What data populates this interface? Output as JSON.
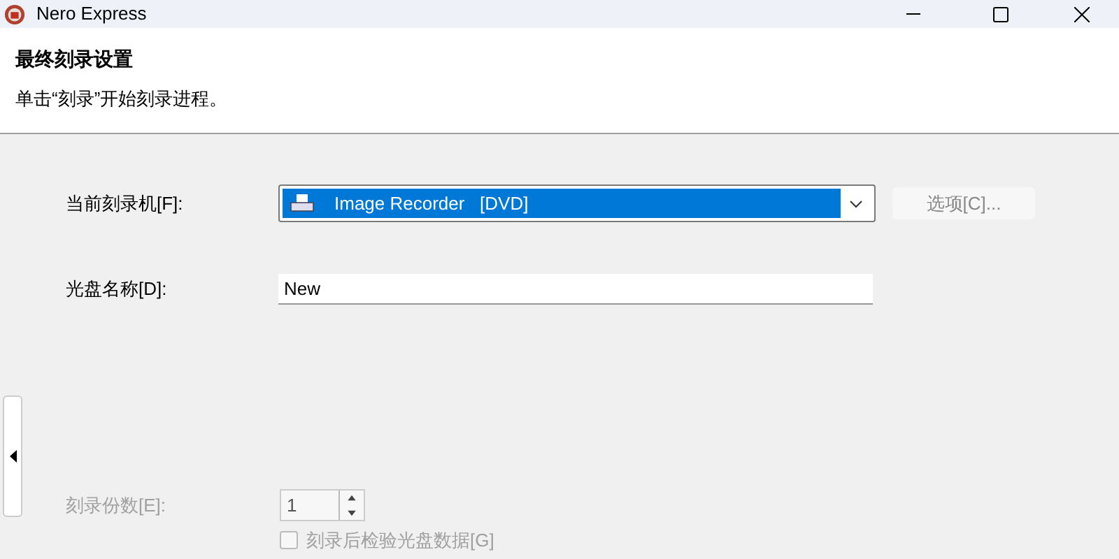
{
  "window": {
    "title": "Nero Express"
  },
  "header": {
    "title": "最终刻录设置",
    "subtitle": "单击“刻录”开始刻录进程。"
  },
  "recorder": {
    "label": "当前刻录机[F]:",
    "value": "Image Recorder   [DVD]"
  },
  "options_button": {
    "label": "选项[C]...",
    "disabled": true
  },
  "disc_name": {
    "label": "光盘名称[D]:",
    "value": "New"
  },
  "copies": {
    "label": "刻录份数[E]:",
    "value": "1",
    "disabled": true
  },
  "verify": {
    "label": "刻录后检验光盘数据[G]",
    "checked": false,
    "disabled": true
  }
}
